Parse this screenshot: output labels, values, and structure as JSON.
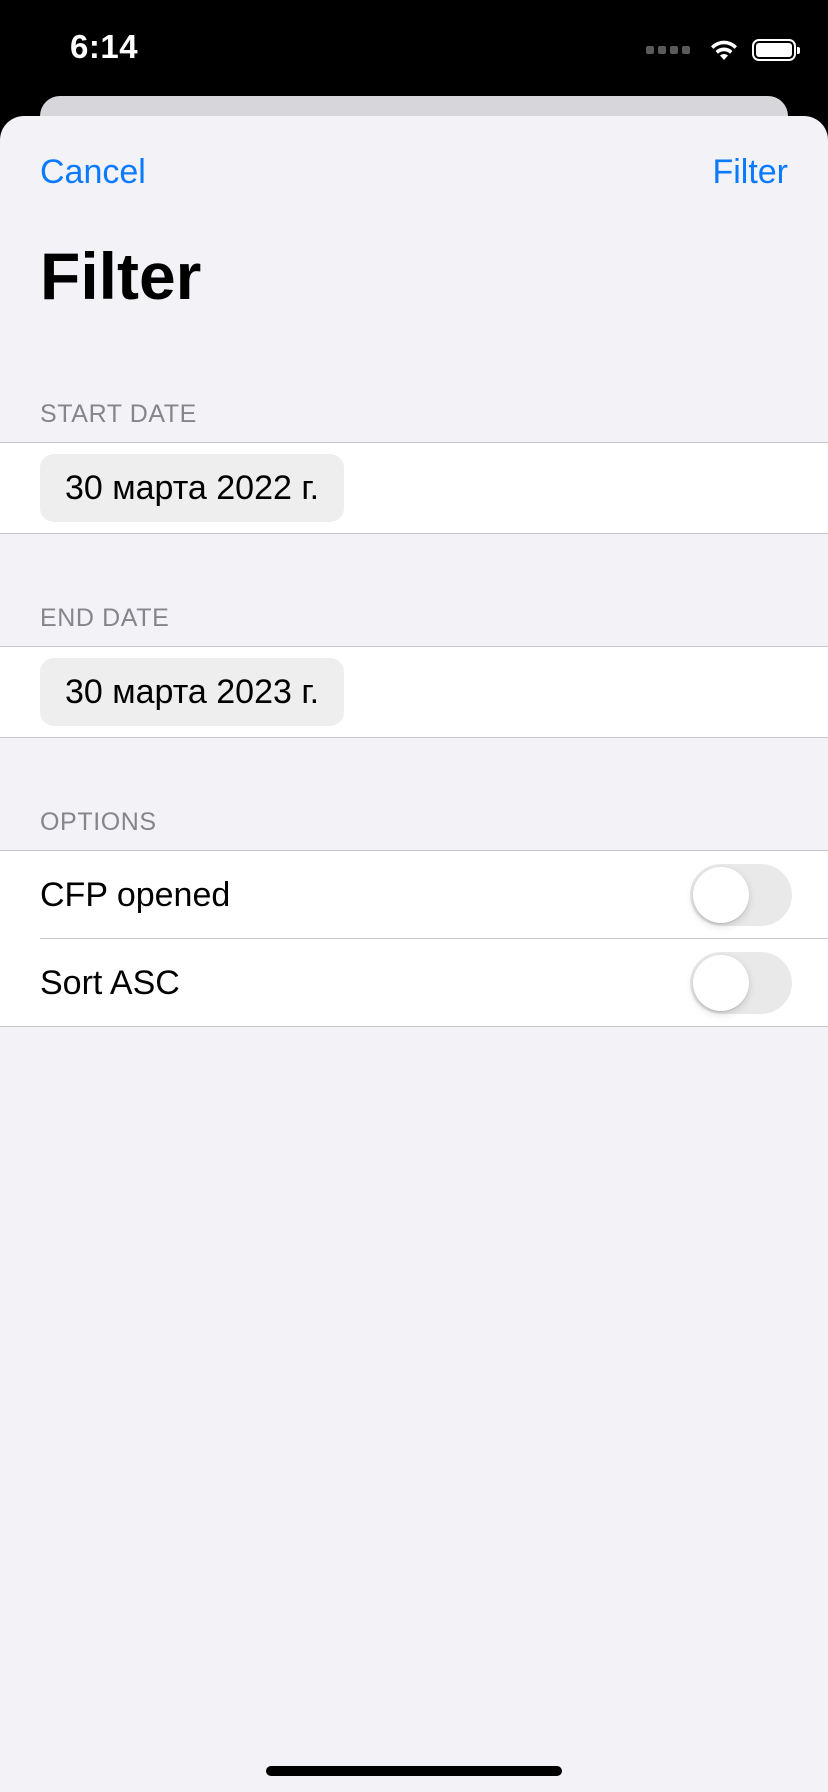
{
  "status_bar": {
    "time": "6:14",
    "signal_icon": "cellular-signal-icon",
    "wifi_icon": "wifi-icon",
    "battery_icon": "battery-icon"
  },
  "nav": {
    "cancel_label": "Cancel",
    "filter_label": "Filter"
  },
  "title": "Filter",
  "sections": {
    "start_date": {
      "header": "START DATE",
      "value": "30 марта 2022 г."
    },
    "end_date": {
      "header": "END DATE",
      "value": "30 марта 2023 г."
    },
    "options": {
      "header": "OPTIONS",
      "items": [
        {
          "label": "CFP opened",
          "on": false
        },
        {
          "label": "Sort ASC",
          "on": false
        }
      ]
    }
  },
  "colors": {
    "accent": "#0a7aff",
    "background": "#f2f2f7",
    "section_header": "#85858b"
  }
}
